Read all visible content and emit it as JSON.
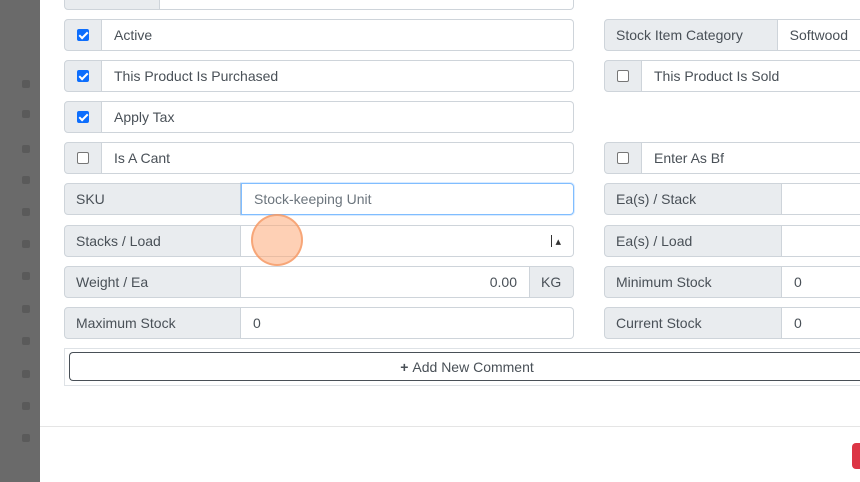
{
  "form": {
    "left": {
      "active": {
        "label": "Active",
        "checked": true
      },
      "purchased": {
        "label": "This Product Is Purchased",
        "checked": true
      },
      "apply_tax": {
        "label": "Apply Tax",
        "checked": true
      },
      "is_cant": {
        "label": "Is A Cant",
        "checked": false
      },
      "sku": {
        "label": "SKU",
        "placeholder": "Stock-keeping Unit",
        "value": ""
      },
      "stacks_load": {
        "label": "Stacks / Load",
        "value": ""
      },
      "weight_ea": {
        "label": "Weight / Ea",
        "value": "0.00",
        "unit": "KG"
      },
      "max_stock": {
        "label": "Maximum Stock",
        "value": "0"
      }
    },
    "right": {
      "category": {
        "label": "Stock Item Category",
        "value": "Softwood"
      },
      "sold": {
        "label": "This Product Is Sold",
        "checked": false
      },
      "enter_bf": {
        "label": "Enter As Bf",
        "checked": false
      },
      "ea_stack": {
        "label": "Ea(s) / Stack",
        "value": ""
      },
      "ea_load": {
        "label": "Ea(s) / Load",
        "value": ""
      },
      "min_stock": {
        "label": "Minimum Stock",
        "value": "0"
      },
      "current_stock": {
        "label": "Current Stock",
        "value": "0"
      }
    },
    "add_comment_label": "Add New Comment",
    "add_comment_icon": "+"
  },
  "colors": {
    "checkbox_on": "#0d6efd",
    "focus_border": "#80bdff",
    "footer_button": "#dc3545"
  }
}
